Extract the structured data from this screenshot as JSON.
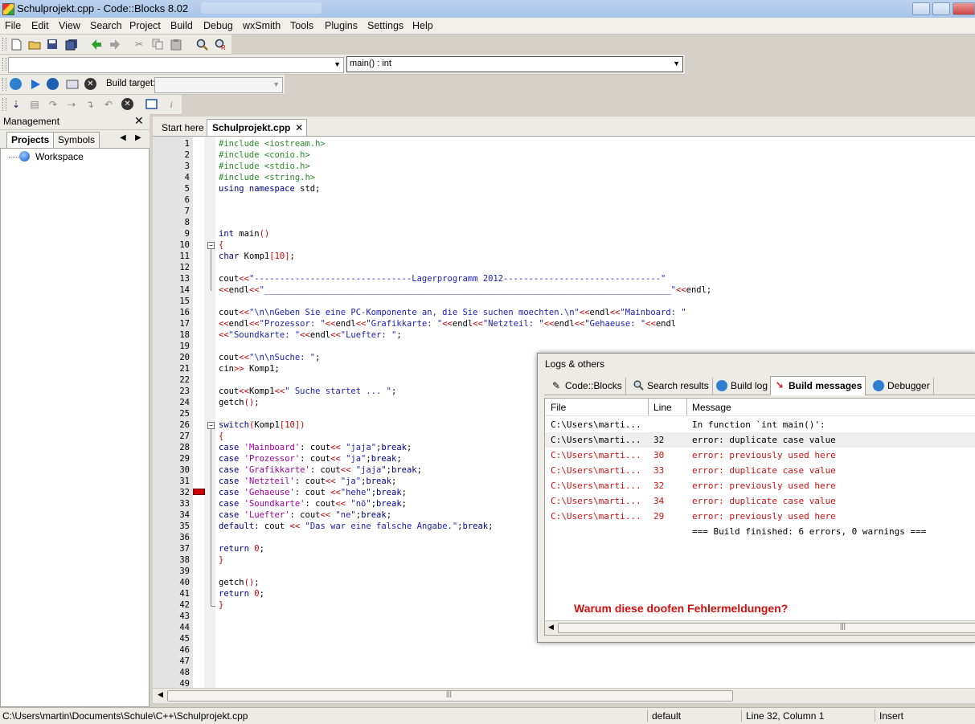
{
  "window": {
    "title": "Schulprojekt.cpp - Code::Blocks 8.02"
  },
  "menu": [
    "File",
    "Edit",
    "View",
    "Search",
    "Project",
    "Build",
    "Debug",
    "wxSmith",
    "Tools",
    "Plugins",
    "Settings",
    "Help"
  ],
  "code_completion": {
    "scope": "",
    "function": "main() : int"
  },
  "compiler_toolbar": {
    "build_target_label": "Build target:",
    "build_target_value": ""
  },
  "management": {
    "title": "Management",
    "tabs": [
      "Projects",
      "Symbols"
    ],
    "tree_root": "Workspace"
  },
  "editor": {
    "tabs": [
      {
        "label": "Start here",
        "active": false
      },
      {
        "label": "Schulprojekt.cpp",
        "active": true
      }
    ],
    "error_line": 32,
    "line_count": 49
  },
  "logs": {
    "title": "Logs & others",
    "tabs": [
      "Code::Blocks",
      "Search results",
      "Build log",
      "Build messages",
      "Debugger"
    ],
    "active_tab": "Build messages",
    "columns": [
      "File",
      "Line",
      "Message"
    ],
    "rows": [
      {
        "file": "C:\\Users\\marti...",
        "line": "",
        "message": "In function `int main()':",
        "kind": "info"
      },
      {
        "file": "C:\\Users\\marti...",
        "line": "32",
        "message": "error: duplicate case value",
        "kind": "selected"
      },
      {
        "file": "C:\\Users\\marti...",
        "line": "30",
        "message": "error: previously used here",
        "kind": "error"
      },
      {
        "file": "C:\\Users\\marti...",
        "line": "33",
        "message": "error: duplicate case value",
        "kind": "error"
      },
      {
        "file": "C:\\Users\\marti...",
        "line": "32",
        "message": "error: previously used here",
        "kind": "error"
      },
      {
        "file": "C:\\Users\\marti...",
        "line": "34",
        "message": "error: duplicate case value",
        "kind": "error"
      },
      {
        "file": "C:\\Users\\marti...",
        "line": "29",
        "message": "error: previously used here",
        "kind": "error"
      },
      {
        "file": "",
        "line": "",
        "message": "=== Build finished: 6 errors, 0 warnings ===",
        "kind": "info"
      }
    ],
    "annotation": "Warum diese doofen Fehlermeldungen?"
  },
  "status": {
    "path": "C:\\Users\\martin\\Documents\\Schule\\C++\\Schulprojekt.cpp",
    "encoding": "default",
    "position": "Line 32, Column 1",
    "mode": "Insert"
  },
  "colors": {
    "error": "#d01010",
    "error_marker": "#cc0000",
    "keyword": "#00008b",
    "preprocessor": "#2a8a2a"
  }
}
